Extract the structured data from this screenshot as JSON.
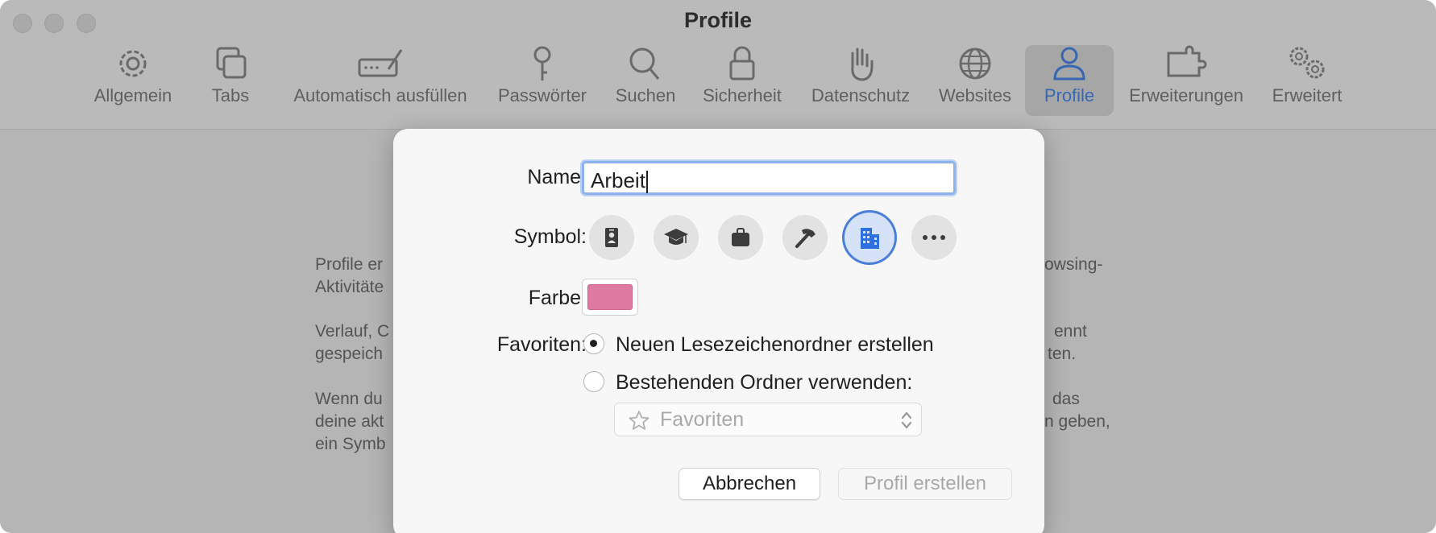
{
  "window": {
    "title": "Profile"
  },
  "toolbar": {
    "items": [
      {
        "label": "Allgemein",
        "icon": "gear-icon"
      },
      {
        "label": "Tabs",
        "icon": "tabs-icon"
      },
      {
        "label": "Automatisch ausfüllen",
        "icon": "autofill-icon"
      },
      {
        "label": "Passwörter",
        "icon": "key-icon"
      },
      {
        "label": "Suchen",
        "icon": "search-icon"
      },
      {
        "label": "Sicherheit",
        "icon": "lock-icon"
      },
      {
        "label": "Datenschutz",
        "icon": "hand-icon"
      },
      {
        "label": "Websites",
        "icon": "globe-icon"
      },
      {
        "label": "Profile",
        "icon": "person-icon",
        "active": true
      },
      {
        "label": "Erweiterungen",
        "icon": "puzzle-icon"
      },
      {
        "label": "Erweitert",
        "icon": "gears-icon"
      }
    ]
  },
  "background_text": {
    "line1_left": "Profile er",
    "line1_right": "owsing-",
    "line2_left": "Aktivitäte",
    "line3_left": "Verlauf, C",
    "line3_right": "ennt",
    "line4_left": "gespeich",
    "line4_right": "ten.",
    "line5_left": "Wenn du",
    "line5_right": "das",
    "line6_left": "deine akt",
    "line6_right": "n geben,",
    "line7_left": "ein Symb"
  },
  "dialog": {
    "name_label": "Name:",
    "name_value": "Arbeit",
    "symbol_label": "Symbol:",
    "symbols": [
      "id-badge-icon",
      "graduation-cap-icon",
      "briefcase-icon",
      "hammer-icon",
      "building-icon",
      "more-icon"
    ],
    "selected_symbol": "building-icon",
    "color_label": "Farbe:",
    "color_value": "#de7aa1",
    "favorites_label": "Favoriten:",
    "radio_new": "Neuen Lesezeichenordner erstellen",
    "radio_existing": "Bestehenden Ordner verwenden:",
    "selected_radio": "new",
    "folder_popup_value": "Favoriten",
    "cancel_button": "Abbrechen",
    "create_button": "Profil erstellen"
  },
  "colors": {
    "accent": "#4a7fd8",
    "profile_color": "#de7aa1"
  }
}
